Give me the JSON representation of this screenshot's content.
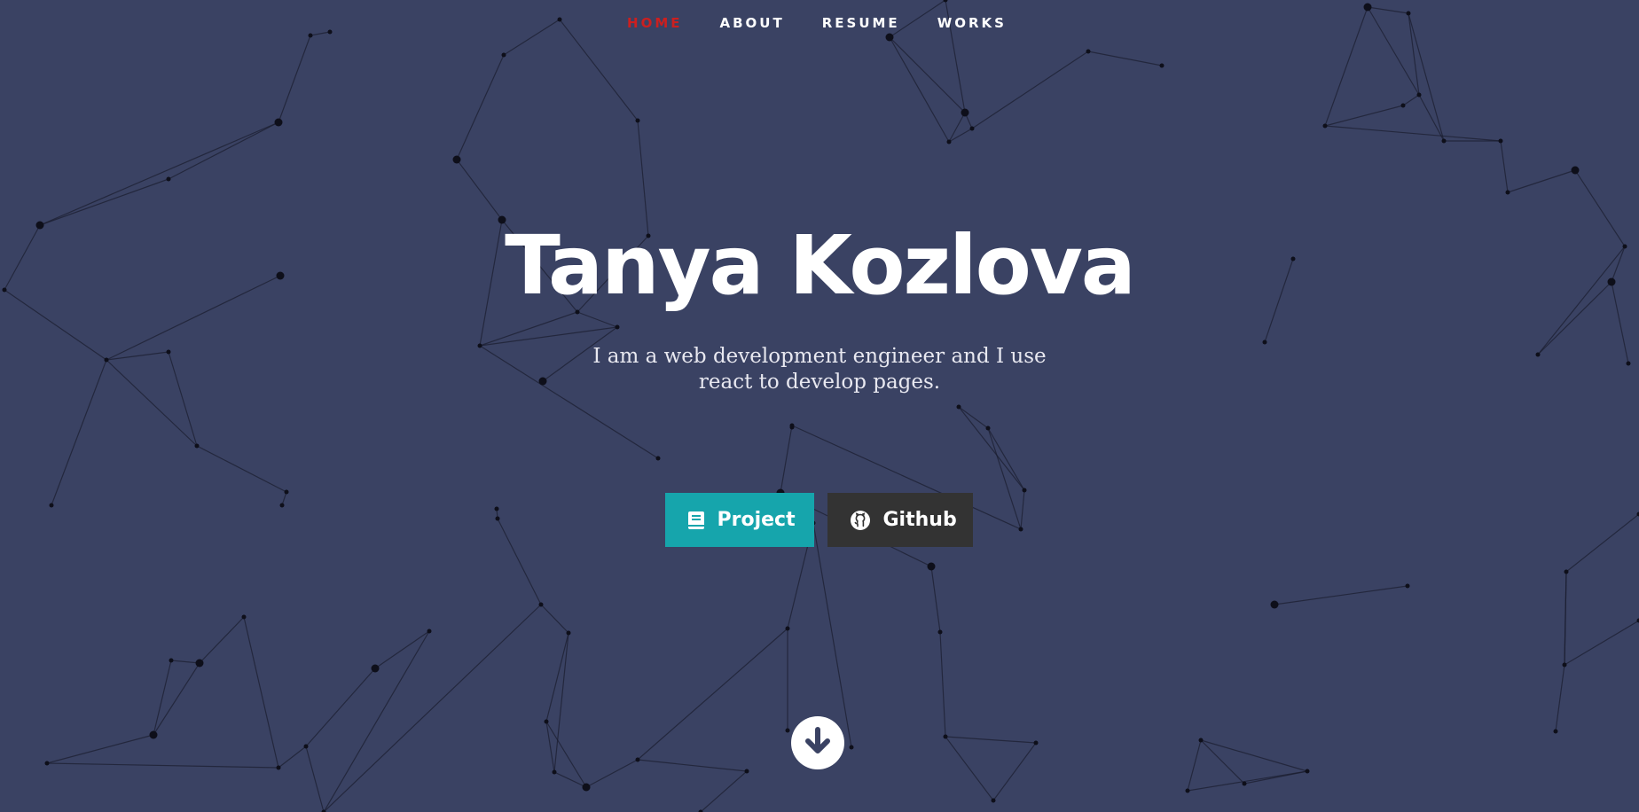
{
  "nav": {
    "items": [
      {
        "label": "HOME",
        "active": true
      },
      {
        "label": "ABOUT",
        "active": false
      },
      {
        "label": "RESUME",
        "active": false
      },
      {
        "label": "WORKS",
        "active": false
      }
    ]
  },
  "hero": {
    "name": "Tanya Kozlova",
    "tagline": "I am a web development engineer and I use react to develop pages."
  },
  "buttons": {
    "project": {
      "label": "Project",
      "icon": "book-icon"
    },
    "github": {
      "label": "Github",
      "icon": "github-icon"
    }
  },
  "scroll": {
    "icon": "arrow-down-circle-icon"
  },
  "colors": {
    "background": "#3a4263",
    "nav_active": "#cc1f1f",
    "project_button": "#16a5ac",
    "github_button": "#333333",
    "network_lines": "#1a1c2e"
  }
}
